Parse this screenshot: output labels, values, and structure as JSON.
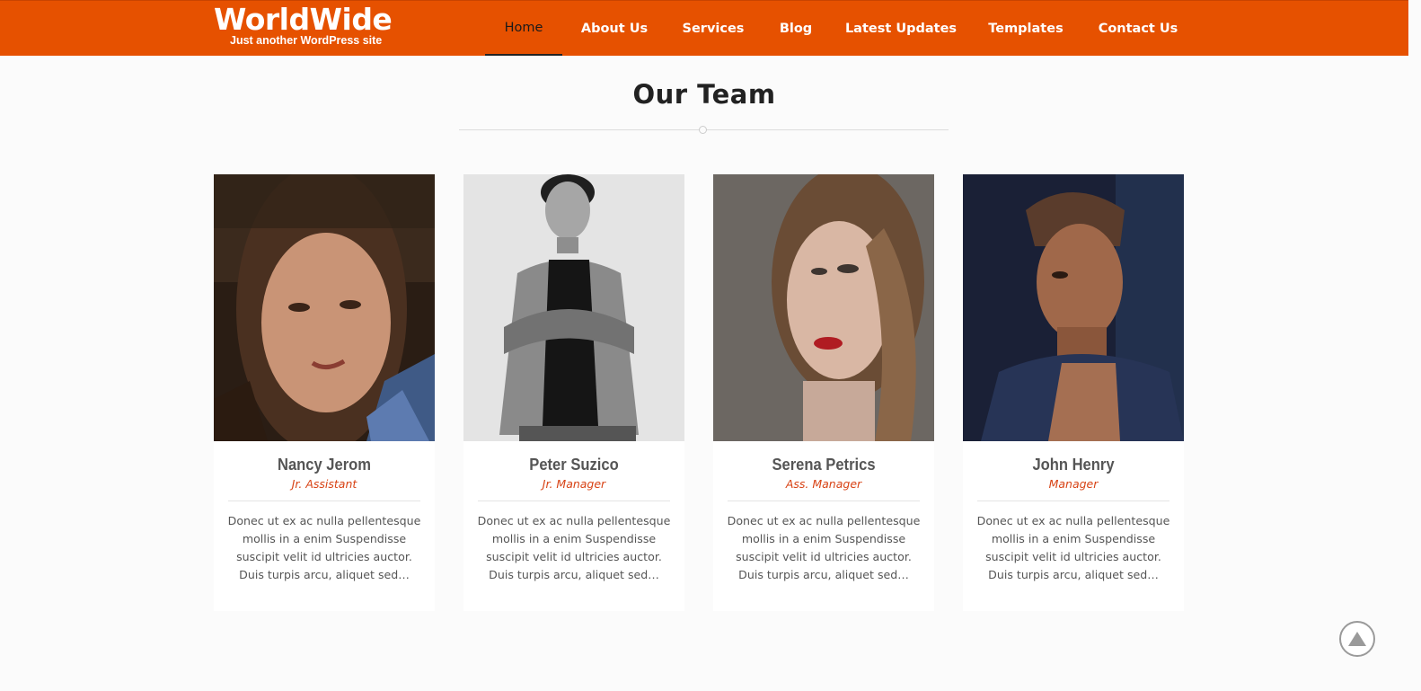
{
  "brand": {
    "title": "WorldWide",
    "tagline": "Just another WordPress site"
  },
  "nav": {
    "items": [
      {
        "label": "Home",
        "active": true
      },
      {
        "label": "About Us"
      },
      {
        "label": "Services"
      },
      {
        "label": "Blog"
      },
      {
        "label": "Latest Updates"
      },
      {
        "label": "Templates"
      },
      {
        "label": "Contact Us"
      }
    ]
  },
  "section": {
    "title": "Our Team"
  },
  "team": [
    {
      "name": "Nancy Jerom",
      "role": "Jr. Assistant",
      "description": "Donec ut ex ac nulla pellentesque mollis in a enim Suspendisse suscipit velit id ultricies auctor. Duis turpis arcu, aliquet sed…"
    },
    {
      "name": "Peter Suzico",
      "role": "Jr. Manager",
      "description": "Donec ut ex ac nulla pellentesque mollis in a enim Suspendisse suscipit velit id ultricies auctor. Duis turpis arcu, aliquet sed…"
    },
    {
      "name": "Serena Petrics",
      "role": "Ass. Manager",
      "description": "Donec ut ex ac nulla pellentesque mollis in a enim Suspendisse suscipit velit id ultricies auctor. Duis turpis arcu, aliquet sed…"
    },
    {
      "name": "John Henry",
      "role": "Manager",
      "description": "Donec ut ex ac nulla pellentesque mollis in a enim Suspendisse suscipit velit id ultricies auctor. Duis turpis arcu, aliquet sed…"
    }
  ],
  "colors": {
    "header": "#e65100",
    "role": "#d84315"
  },
  "icons": {
    "scroll_top": "triangle-up-icon"
  }
}
